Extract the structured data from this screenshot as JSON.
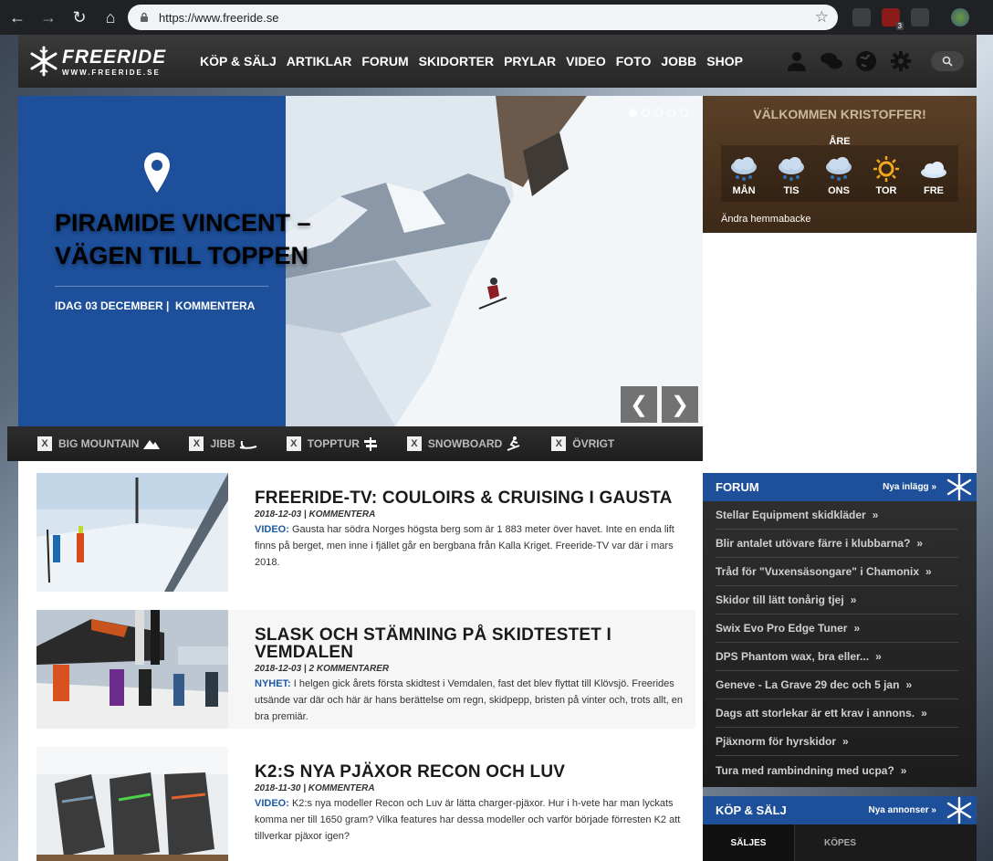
{
  "browser": {
    "url": "https://www.freeride.se"
  },
  "header": {
    "logo_text": "FREERIDE",
    "logo_sub": "WWW.FREERIDE.SE",
    "nav": [
      "KÖP & SÄLJ",
      "ARTIKLAR",
      "FORUM",
      "SKIDORTER",
      "PRYLAR",
      "VIDEO",
      "FOTO",
      "JOBB",
      "SHOP"
    ]
  },
  "hero": {
    "title": "PIRAMIDE VINCENT – VÄGEN TILL TOPPEN",
    "date": "IDAG 03 DECEMBER",
    "comment": "KOMMENTERA",
    "prev": "❮",
    "next": "❯"
  },
  "filters": [
    "BIG MOUNTAIN",
    "JIBB",
    "TOPPTUR",
    "SNOWBOARD",
    "ÖVRIGT"
  ],
  "articles": [
    {
      "title": "FREERIDE-TV: COULOIRS & CRUISING I GAUSTA",
      "date": "2018-12-03",
      "comments": "KOMMENTERA",
      "kind": "VIDEO:",
      "excerpt": "Gausta har södra Norges högsta berg som är 1 883 meter över havet. Inte en enda lift finns på berget, men inne i fjället går en bergbana från Kalla Kriget. Freeride-TV var där i mars 2018."
    },
    {
      "title": "SLASK OCH STÄMNING PÅ SKIDTESTET I VEMDALEN",
      "date": "2018-12-03",
      "comments": "2 KOMMENTARER",
      "kind": "NYHET:",
      "excerpt": "I helgen gick årets första skidtest i Vemdalen, fast det blev flyttat till Klövsjö. Freerides utsände var där och här är hans berättelse om regn, skidpepp, bristen på vinter och, trots allt, en bra premiär."
    },
    {
      "title": "K2:S NYA PJÄXOR RECON OCH LUV",
      "date": "2018-11-30",
      "comments": "KOMMENTERA",
      "kind": "VIDEO:",
      "excerpt": "K2:s nya modeller Recon och Luv är lätta charger-pjäxor. Hur i h-vete har man lyckats komma ner till 1650 gram? Vilka features har dessa modeller och varför började förresten K2 att tillverkar pjäxor igen?"
    }
  ],
  "welcome": {
    "greeting": "VÄLKOMMEN KRISTOFFER!",
    "place": "ÅRE",
    "days": [
      "MÅN",
      "TIS",
      "ONS",
      "TOR",
      "FRE"
    ],
    "change": "Ändra hemmabacke"
  },
  "forum": {
    "title": "FORUM",
    "more": "Nya inlägg »",
    "items": [
      "Stellar Equipment skidkläder",
      "Blir antalet utövare färre i klubbarna?",
      "Tråd för \"Vuxensäsongare\" i Chamonix",
      "Skidor till lätt tonårig tjej",
      "Swix Evo Pro Edge Tuner",
      "DPS Phantom wax, bra eller...",
      "Geneve - La Grave 29 dec och 5 jan",
      "Dags att storlekar är ett krav i annons.",
      "Pjäxnorm för hyrskidor",
      "Tura med rambindning med ucpa?"
    ]
  },
  "market": {
    "title": "KÖP & SÄLJ",
    "more": "Nya annonser »",
    "tabs": [
      "SÄLJES",
      "KÖPES"
    ]
  }
}
